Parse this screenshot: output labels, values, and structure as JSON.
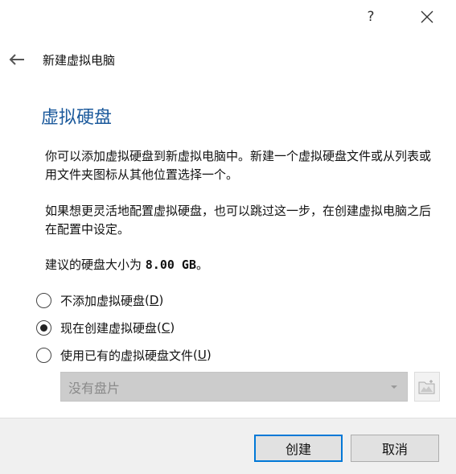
{
  "window": {
    "help_label": "?",
    "close_icon": "close-icon"
  },
  "header": {
    "title": "新建虚拟电脑",
    "back_icon": "arrow-left-icon"
  },
  "page": {
    "title": "虚拟硬盘",
    "para1": "你可以添加虚拟硬盘到新虚拟电脑中。新建一个虚拟硬盘文件或从列表或用文件夹图标从其他位置选择一个。",
    "para2": "如果想更灵活地配置虚拟硬盘，也可以跳过这一步，在创建虚拟电脑之后在配置中设定。",
    "size_prefix": "建议的硬盘大小为 ",
    "size_value": "8.00 GB",
    "size_suffix": "。"
  },
  "options": [
    {
      "label": "不添加虚拟硬盘",
      "key": "D",
      "selected": false
    },
    {
      "label": "现在创建虚拟硬盘",
      "key": "C",
      "selected": true
    },
    {
      "label": "使用已有的虚拟硬盘文件",
      "key": "U",
      "selected": false
    }
  ],
  "disk_select": {
    "value": "没有盘片",
    "enabled": false
  },
  "buttons": {
    "create": "创建",
    "cancel": "取消"
  },
  "colors": {
    "title_blue": "#1c5a9c",
    "default_button_border": "#0078d7"
  }
}
